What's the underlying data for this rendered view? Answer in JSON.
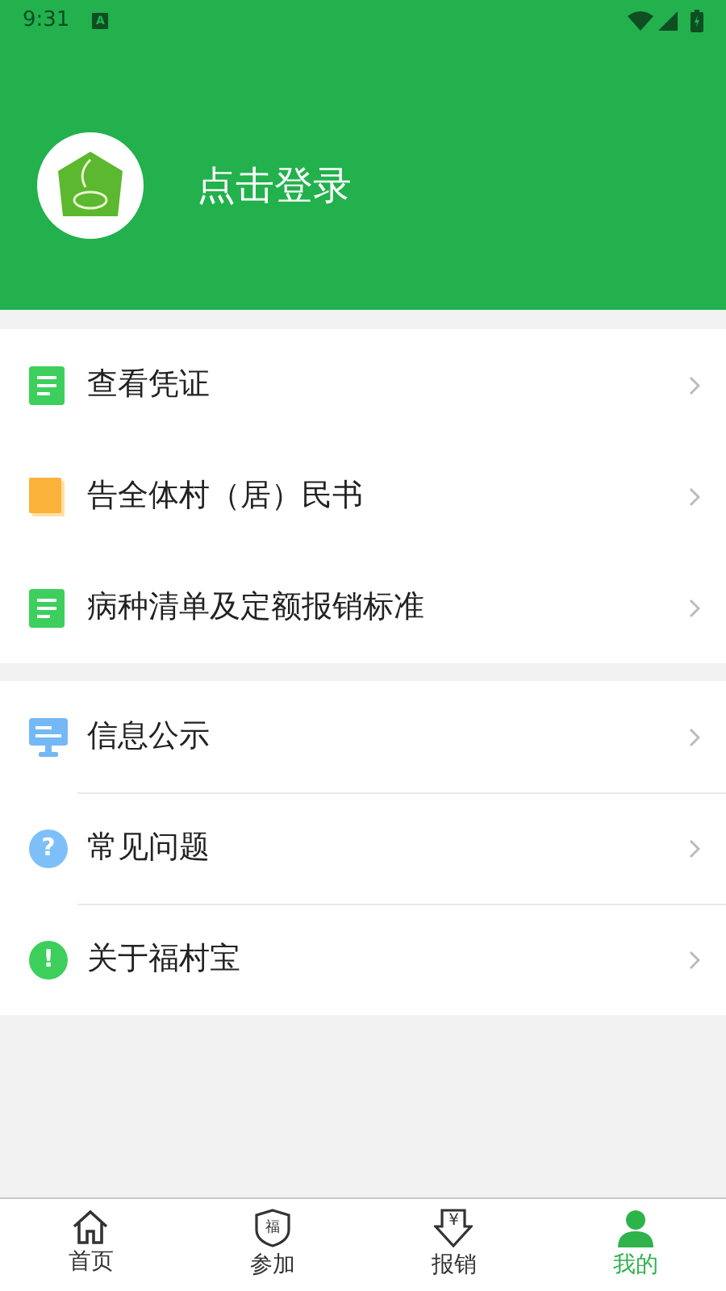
{
  "status_bar": {
    "time": "9:31",
    "notification_glyph": "A"
  },
  "header": {
    "login_label": "点击登录"
  },
  "sections": [
    {
      "items": [
        {
          "kind": "document",
          "label": "查看凭证"
        },
        {
          "kind": "book",
          "label": "告全体村（居）民书"
        },
        {
          "kind": "document",
          "label": "病种清单及定额报销标准"
        }
      ]
    },
    {
      "items": [
        {
          "kind": "monitor",
          "label": "信息公示"
        },
        {
          "kind": "question",
          "label": "常见问题",
          "glyph": "?"
        },
        {
          "kind": "info",
          "label": "关于福村宝",
          "glyph": "!"
        }
      ]
    }
  ],
  "bottom_nav": [
    {
      "kind": "home",
      "label": "首页",
      "selected": false
    },
    {
      "kind": "shield",
      "label": "参加",
      "glyph": "福",
      "selected": false
    },
    {
      "kind": "receipt",
      "label": "报销",
      "glyph": "¥",
      "selected": false
    },
    {
      "kind": "person",
      "label": "我的",
      "selected": true
    }
  ]
}
